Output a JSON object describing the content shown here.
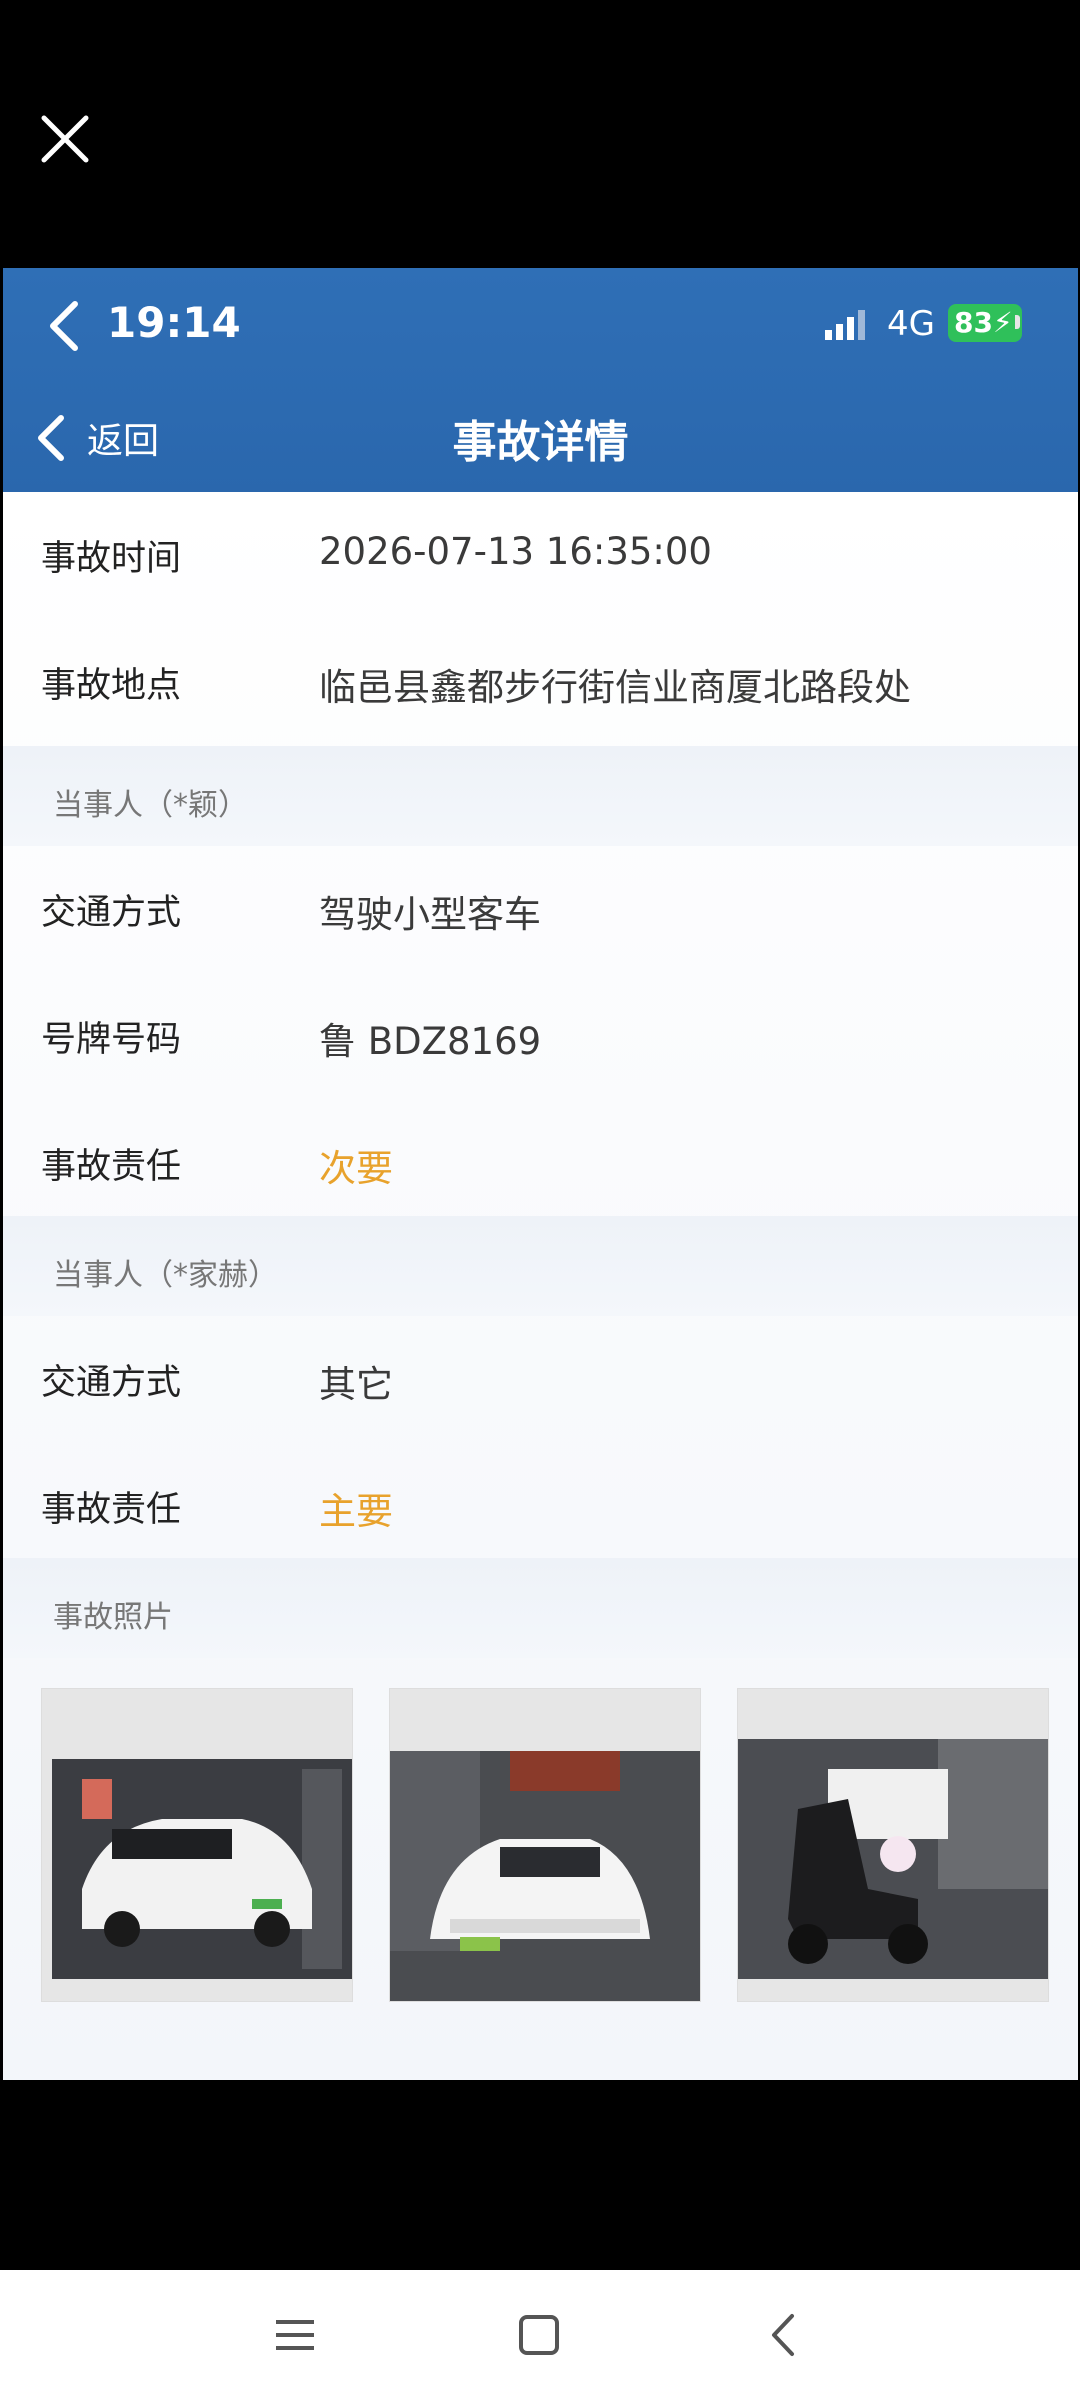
{
  "viewer": {
    "close_icon": "close-icon"
  },
  "status_bar": {
    "time": "19:14",
    "network": "4G",
    "battery": "83"
  },
  "header": {
    "back_label": "返回",
    "title": "事故详情"
  },
  "accident": {
    "time_label": "事故时间",
    "time_value": "2026-07-13 16:35:00",
    "place_label": "事故地点",
    "place_value": "临邑县鑫都步行街信业商厦北路段处"
  },
  "parties": [
    {
      "header": "当事人（*颖）",
      "mode_label": "交通方式",
      "mode_value": "驾驶小型客车",
      "plate_label": "号牌号码",
      "plate_value": "鲁 BDZ8169",
      "resp_label": "事故责任",
      "resp_value": "次要"
    },
    {
      "header": "当事人（*家赫）",
      "mode_label": "交通方式",
      "mode_value": "其它",
      "resp_label": "事故责任",
      "resp_value": "主要"
    }
  ],
  "photos": {
    "header": "事故照片",
    "count": 3
  },
  "colors": {
    "header_blue": "#2f6fb6",
    "responsibility_orange": "#e8a22c",
    "battery_green": "#2fc05a"
  }
}
